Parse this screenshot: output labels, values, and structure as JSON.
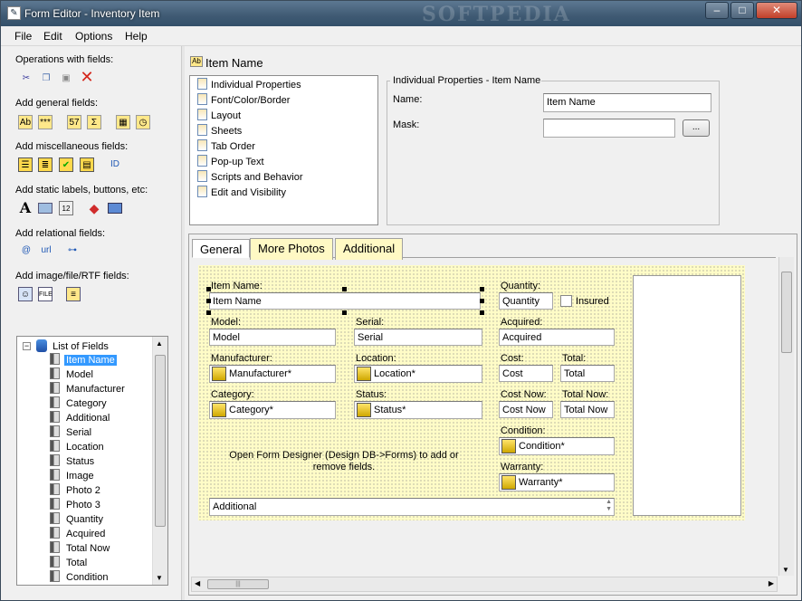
{
  "window": {
    "title": "Form Editor - Inventory Item",
    "watermark": "SOFTPEDIA",
    "controls": {
      "minimize": "–",
      "maximize": "□",
      "close": "✕"
    }
  },
  "menubar": [
    "File",
    "Edit",
    "Options",
    "Help"
  ],
  "toolbox": {
    "groups": [
      {
        "label": "Operations with fields:",
        "icons": [
          "scissors-icon",
          "copy-icon",
          "paste-icon",
          "delete-icon"
        ]
      },
      {
        "label": "Add general fields:",
        "icons": [
          "text-field-icon",
          "password-field-icon",
          "number-field-icon",
          "sum-field-icon",
          "date-field-icon",
          "time-field-icon"
        ]
      },
      {
        "label": "Add miscellaneous fields:",
        "icons": [
          "list-field-icon",
          "memo-field-icon",
          "checkbox-field-icon",
          "table-field-icon",
          "id-field-icon"
        ]
      },
      {
        "label": "Add static labels, buttons, etc:",
        "icons": [
          "label-icon",
          "box-icon",
          "counter-icon",
          "button-icon",
          "image-icon"
        ]
      },
      {
        "label": "Add relational fields:",
        "icons": [
          "email-icon",
          "url-icon",
          "tree-icon"
        ]
      },
      {
        "label": "Add image/file/RTF fields:",
        "icons": [
          "picture-field-icon",
          "file-field-icon",
          "rtf-field-icon"
        ]
      }
    ],
    "glyphs": {
      "text-field-icon": "Ab",
      "password-field-icon": "***",
      "number-field-icon": "57",
      "sum-field-icon": "Σ",
      "id-field-icon": "ID",
      "label-icon": "A",
      "counter-icon": "12",
      "email-icon": "@",
      "url-icon": "url"
    }
  },
  "fields_tree": {
    "root": "List of Fields",
    "items": [
      "Item Name",
      "Model",
      "Manufacturer",
      "Category",
      "Additional",
      "Serial",
      "Location",
      "Status",
      "Image",
      "Photo 2",
      "Photo 3",
      "Quantity",
      "Acquired",
      "Total Now",
      "Total",
      "Condition"
    ],
    "selected": "Item Name"
  },
  "field_header": {
    "icon": "Ab",
    "name": "Item Name"
  },
  "properties": {
    "list": [
      "Individual Properties",
      "Font/Color/Border",
      "Layout",
      "Sheets",
      "Tab Order",
      "Pop-up Text",
      "Scripts and Behavior",
      "Edit and Visibility"
    ],
    "group_title": "Individual Properties - Item Name",
    "name_label": "Name:",
    "name_value": "Item Name",
    "mask_label": "Mask:",
    "mask_value": "",
    "browse_button": "..."
  },
  "tabs": [
    "General",
    "More Photos",
    "Additional"
  ],
  "active_tab": "General",
  "designer": {
    "item_name": {
      "label": "Item Name:",
      "value": "Item Name"
    },
    "model": {
      "label": "Model:",
      "value": "Model"
    },
    "serial": {
      "label": "Serial:",
      "value": "Serial"
    },
    "manufacturer": {
      "label": "Manufacturer:",
      "value": "Manufacturer*"
    },
    "location": {
      "label": "Location:",
      "value": "Location*"
    },
    "category": {
      "label": "Category:",
      "value": "Category*"
    },
    "status": {
      "label": "Status:",
      "value": "Status*"
    },
    "quantity": {
      "label": "Quantity:",
      "value": "Quantity"
    },
    "insured": {
      "label": "Insured",
      "checked": false
    },
    "acquired": {
      "label": "Acquired:",
      "value": "Acquired"
    },
    "cost": {
      "label": "Cost:",
      "value": "Cost"
    },
    "total": {
      "label": "Total:",
      "value": "Total"
    },
    "cost_now": {
      "label": "Cost Now:",
      "value": "Cost Now"
    },
    "total_now": {
      "label": "Total Now:",
      "value": "Total Now"
    },
    "condition": {
      "label": "Condition:",
      "value": "Condition*"
    },
    "warranty": {
      "label": "Warranty:",
      "value": "Warranty*"
    },
    "hint": "Open Form Designer (Design DB->Forms) to add or remove fields.",
    "additional": "Additional"
  }
}
